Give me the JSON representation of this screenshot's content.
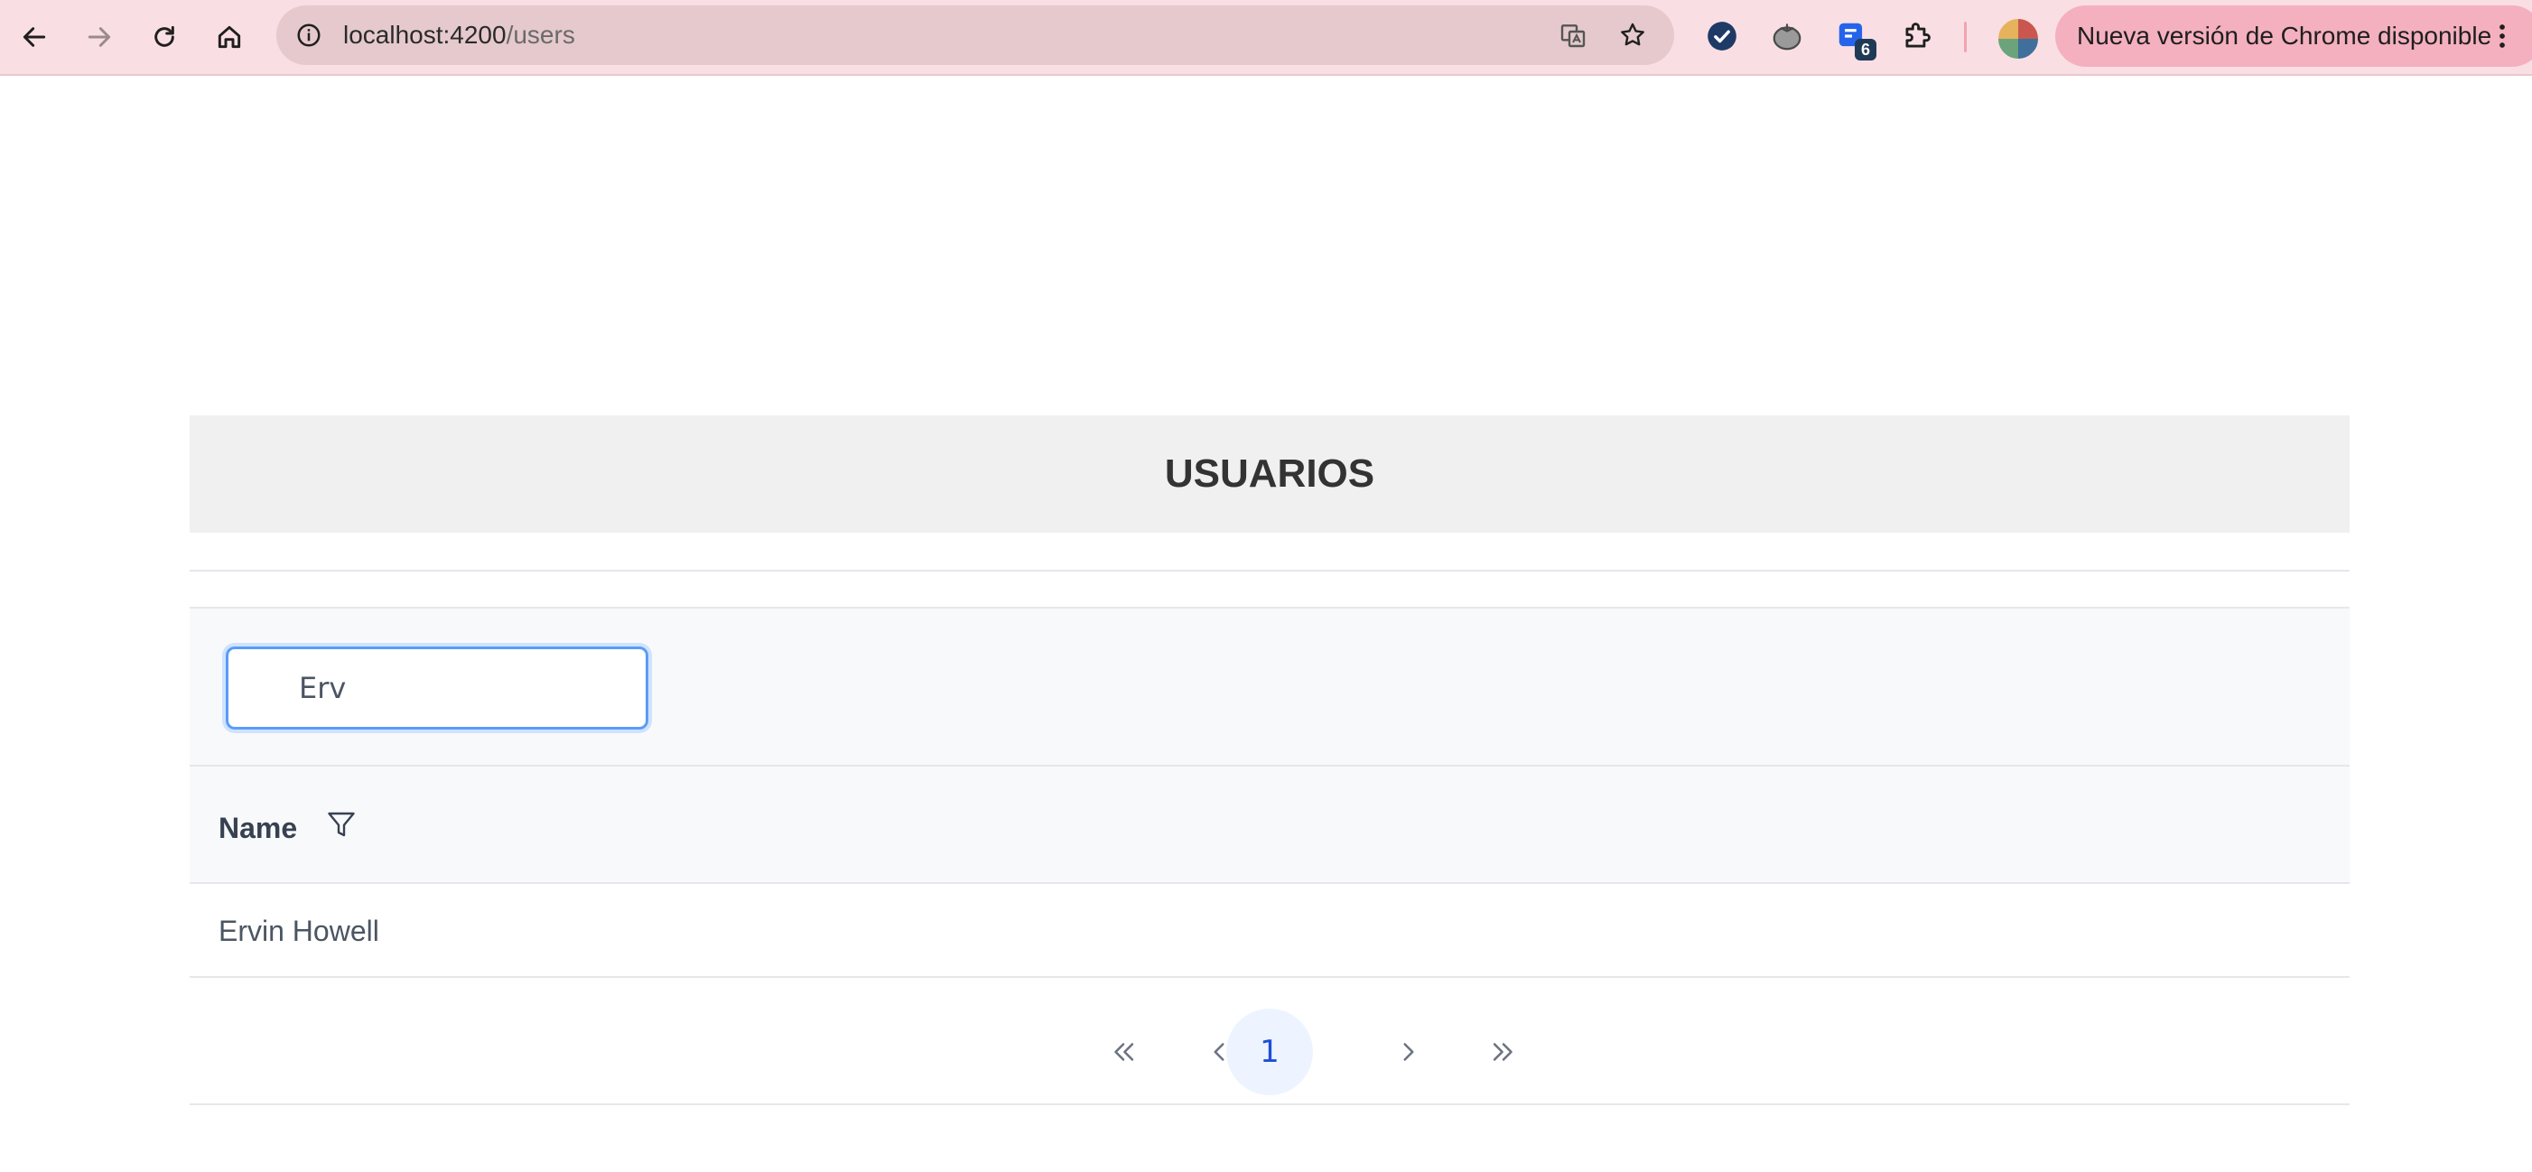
{
  "browser": {
    "url_host": "localhost:4200",
    "url_path": "/users",
    "update_label": "Nueva versión de Chrome disponible",
    "extension_badge": "6",
    "accent_color": "#f9dfe3",
    "icons": [
      "back-icon",
      "forward-icon",
      "reload-icon",
      "home-icon",
      "site-info-icon",
      "translate-icon",
      "bookmark-star-icon",
      "extension-check-icon",
      "extension-tomato-icon",
      "extension-badge-icon",
      "extensions-puzzle-icon",
      "profile-avatar",
      "menu-kebab-icon"
    ]
  },
  "page": {
    "title": "USUARIOS"
  },
  "table": {
    "search_value": "Erv",
    "columns": [
      {
        "label": "Name",
        "filter_icon": "filter-funnel-icon"
      }
    ],
    "rows": [
      {
        "name": "Ervin Howell"
      }
    ]
  },
  "paginator": {
    "current_page": "1",
    "active_color": "#1d4ed8"
  }
}
